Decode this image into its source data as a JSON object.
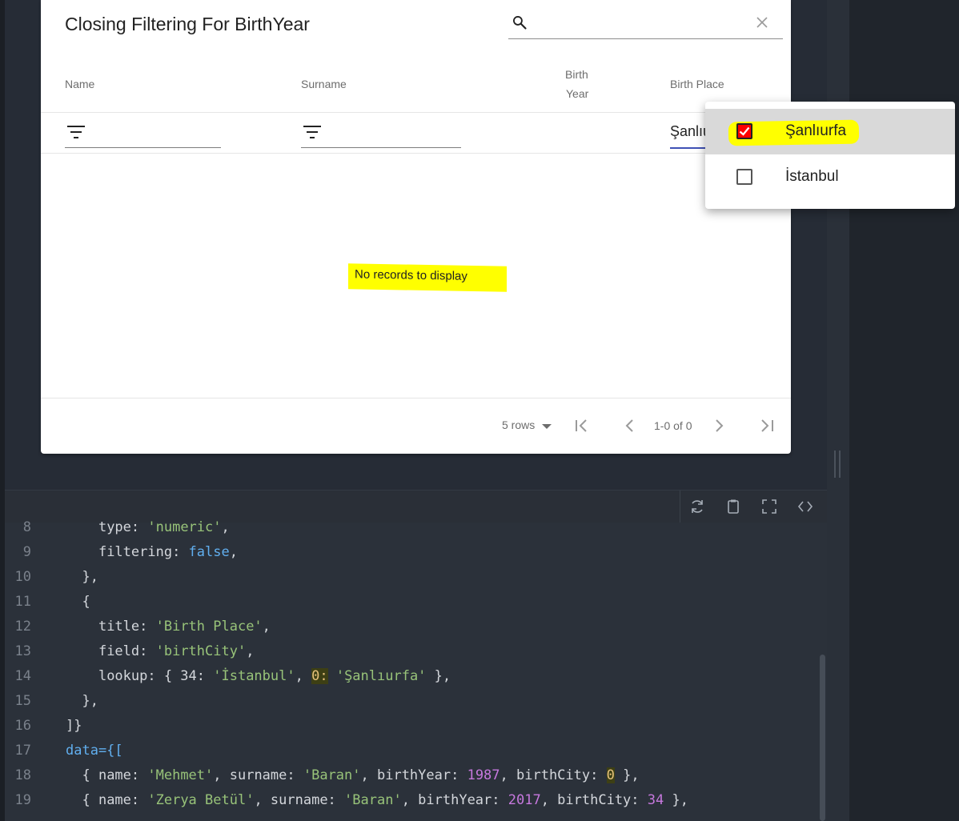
{
  "card": {
    "title": "Closing Filtering For BirthYear",
    "search_placeholder": ""
  },
  "columns": {
    "name": "Name",
    "surname": "Surname",
    "birth_year_l1": "Birth",
    "birth_year_l2": "Year",
    "birth_place": "Birth Place"
  },
  "lookup_filter_value": "Şanlıurfa",
  "table": {
    "empty_message": "No records to display"
  },
  "pagination": {
    "rows_label": "5 rows",
    "range": "1-0 of 0"
  },
  "dropdown": {
    "options": [
      {
        "label": "Şanlıurfa",
        "checked": true
      },
      {
        "label": "İstanbul",
        "checked": false
      }
    ]
  },
  "code": {
    "lines": [
      {
        "n": "8"
      },
      {
        "n": "9"
      },
      {
        "n": "10"
      },
      {
        "n": "11"
      },
      {
        "n": "12"
      },
      {
        "n": "13"
      },
      {
        "n": "14"
      },
      {
        "n": "15"
      },
      {
        "n": "16"
      },
      {
        "n": "17"
      },
      {
        "n": "18"
      },
      {
        "n": "19"
      }
    ],
    "t": {
      "type_key": "type: ",
      "type_val": "'numeric'",
      "filtering_key": "filtering: ",
      "filtering_val": "false",
      "close_obj": "},",
      "open_obj": "{",
      "title_key": "title: ",
      "title_val": "'Birth Place'",
      "field_key": "field: ",
      "field_val": "'birthCity'",
      "lookup_key": "lookup: { 34: ",
      "lookup_ist": "'İstanbul'",
      "lookup_zero": "0:",
      "lookup_sanli": "'Şanlıurfa'",
      "lookup_end": " },",
      "close_cols": "]}",
      "data_open": "data={[",
      "r1_a": "{ name: ",
      "r1_name": "'Mehmet'",
      "r1_b": ", surname: ",
      "r1_sur": "'Baran'",
      "r1_c": ", birthYear: ",
      "r1_year": "1987",
      "r1_d": ", birthCity: ",
      "r1_city": "0",
      "r1_e": " },",
      "r2_name": "'Zerya Betül'",
      "r2_year": "2017",
      "r2_city": "34"
    }
  },
  "colors": {
    "highlight": "#ffff00",
    "accent": "#3f51b5",
    "check": "#ff0000"
  }
}
